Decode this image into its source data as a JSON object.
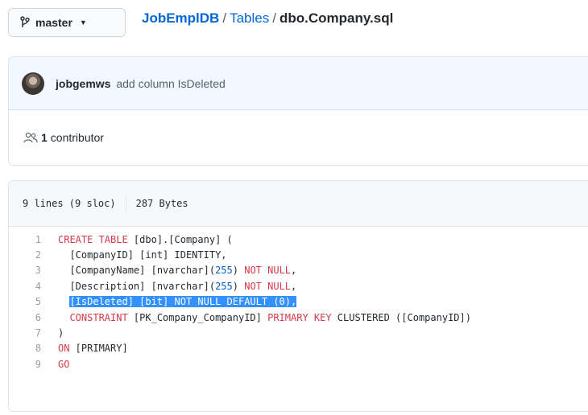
{
  "branch": {
    "label": "master"
  },
  "breadcrumb": {
    "repo": "JobEmplDB",
    "folder": "Tables",
    "file": "dbo.Company.sql",
    "separator": "/"
  },
  "commit": {
    "author": "jobgemws",
    "message": "add column IsDeleted"
  },
  "contributors": {
    "count": "1",
    "label": "contributor"
  },
  "file_info": {
    "lines": "9 lines (9 sloc)",
    "size": "287 Bytes"
  },
  "code": {
    "line_numbers": [
      "1",
      "2",
      "3",
      "4",
      "5",
      "6",
      "7",
      "8",
      "9"
    ],
    "l1": {
      "kw1": "CREATE TABLE",
      "rest": " [dbo].[Company] ("
    },
    "l2": {
      "indent": "  ",
      "rest": "[CompanyID] [int] IDENTITY,"
    },
    "l3": {
      "indent": "  ",
      "pre": "[CompanyName] [nvarchar](",
      "num": "255",
      "mid": ") ",
      "kw": "NOT NULL",
      "end": ","
    },
    "l4": {
      "indent": "  ",
      "pre": "[Description] [nvarchar](",
      "num": "255",
      "mid": ") ",
      "kw": "NOT NULL",
      "end": ","
    },
    "l5": {
      "indent": "  ",
      "selected": "[IsDeleted] [bit] NOT NULL DEFAULT (0),"
    },
    "l6": {
      "indent": "  ",
      "kw1": "CONSTRAINT",
      "mid1": " [PK_Company_CompanyID] ",
      "kw2": "PRIMARY KEY",
      "rest": " CLUSTERED ([CompanyID])"
    },
    "l7": {
      "rest": ")"
    },
    "l8": {
      "kw1": "ON",
      "rest": " [PRIMARY]"
    },
    "l9": {
      "kw1": "GO"
    }
  },
  "colors": {
    "link": "#0366d6",
    "keyword": "#d73a49",
    "number": "#005cc5",
    "selection": "#3390ff",
    "commit_bg": "#f1f8ff"
  },
  "icons": {
    "branch": "git-branch-icon",
    "caret": "caret-down-icon",
    "contributors": "people-icon"
  }
}
